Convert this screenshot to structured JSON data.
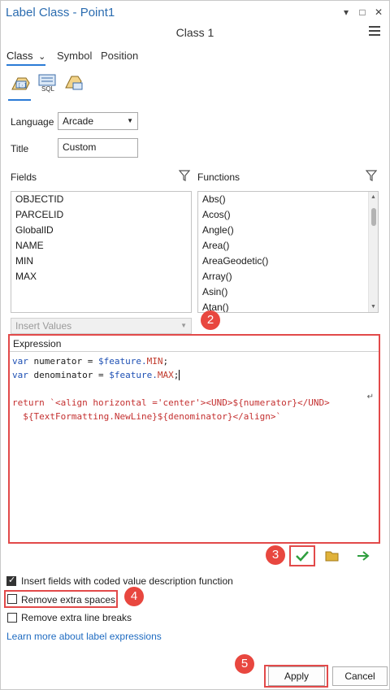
{
  "window": {
    "title": "Label Class - Point1",
    "subtitle": "Class 1"
  },
  "tabs": [
    {
      "label": "Class"
    },
    {
      "label": "Symbol"
    },
    {
      "label": "Position"
    }
  ],
  "mode_icons": {
    "sql_label": "SQL"
  },
  "form": {
    "language_label": "Language",
    "language_value": "Arcade",
    "title_label": "Title",
    "title_value": "Custom"
  },
  "fields": {
    "header": "Fields",
    "items": [
      "OBJECTID",
      "PARCELID",
      "GlobalID",
      "NAME",
      "MIN",
      "MAX"
    ],
    "insert_values": "Insert Values"
  },
  "functions": {
    "header": "Functions",
    "items": [
      "Abs()",
      "Acos()",
      "Angle()",
      "Area()",
      "AreaGeodetic()",
      "Array()",
      "Asin()",
      "Atan()"
    ]
  },
  "expression": {
    "header": "Expression",
    "line1_kw": "var",
    "line1_rest": " numerator = ",
    "line1_feat": "$feature.",
    "line1_field": "MIN",
    "line1_end": ";",
    "line2_kw": "var",
    "line2_rest": " denominator = ",
    "line2_feat": "$feature.",
    "line2_field": "MAX",
    "line2_end": ";",
    "line4_kw": "return",
    "line4_str": " `<align horizontal ='center'><UND>${numerator}</UND>",
    "line5_str": "  ${TextFormatting.NewLine}${denominator}</align>`",
    "wrap_glyph": "↵"
  },
  "options": {
    "coded_value": {
      "label": "Insert fields with coded value description function",
      "checked": true
    },
    "remove_spaces": {
      "label": "Remove extra spaces",
      "checked": false
    },
    "remove_breaks": {
      "label": "Remove extra line breaks",
      "checked": false
    },
    "learn_more": "Learn more about label expressions"
  },
  "buttons": {
    "apply": "Apply",
    "cancel": "Cancel"
  },
  "badges": [
    "2",
    "3",
    "4",
    "5"
  ],
  "colors": {
    "accent": "#2b7bd6",
    "annotation": "#e24a4a",
    "verify_green": "#2e9e3e",
    "folder": "#e0b23a"
  }
}
